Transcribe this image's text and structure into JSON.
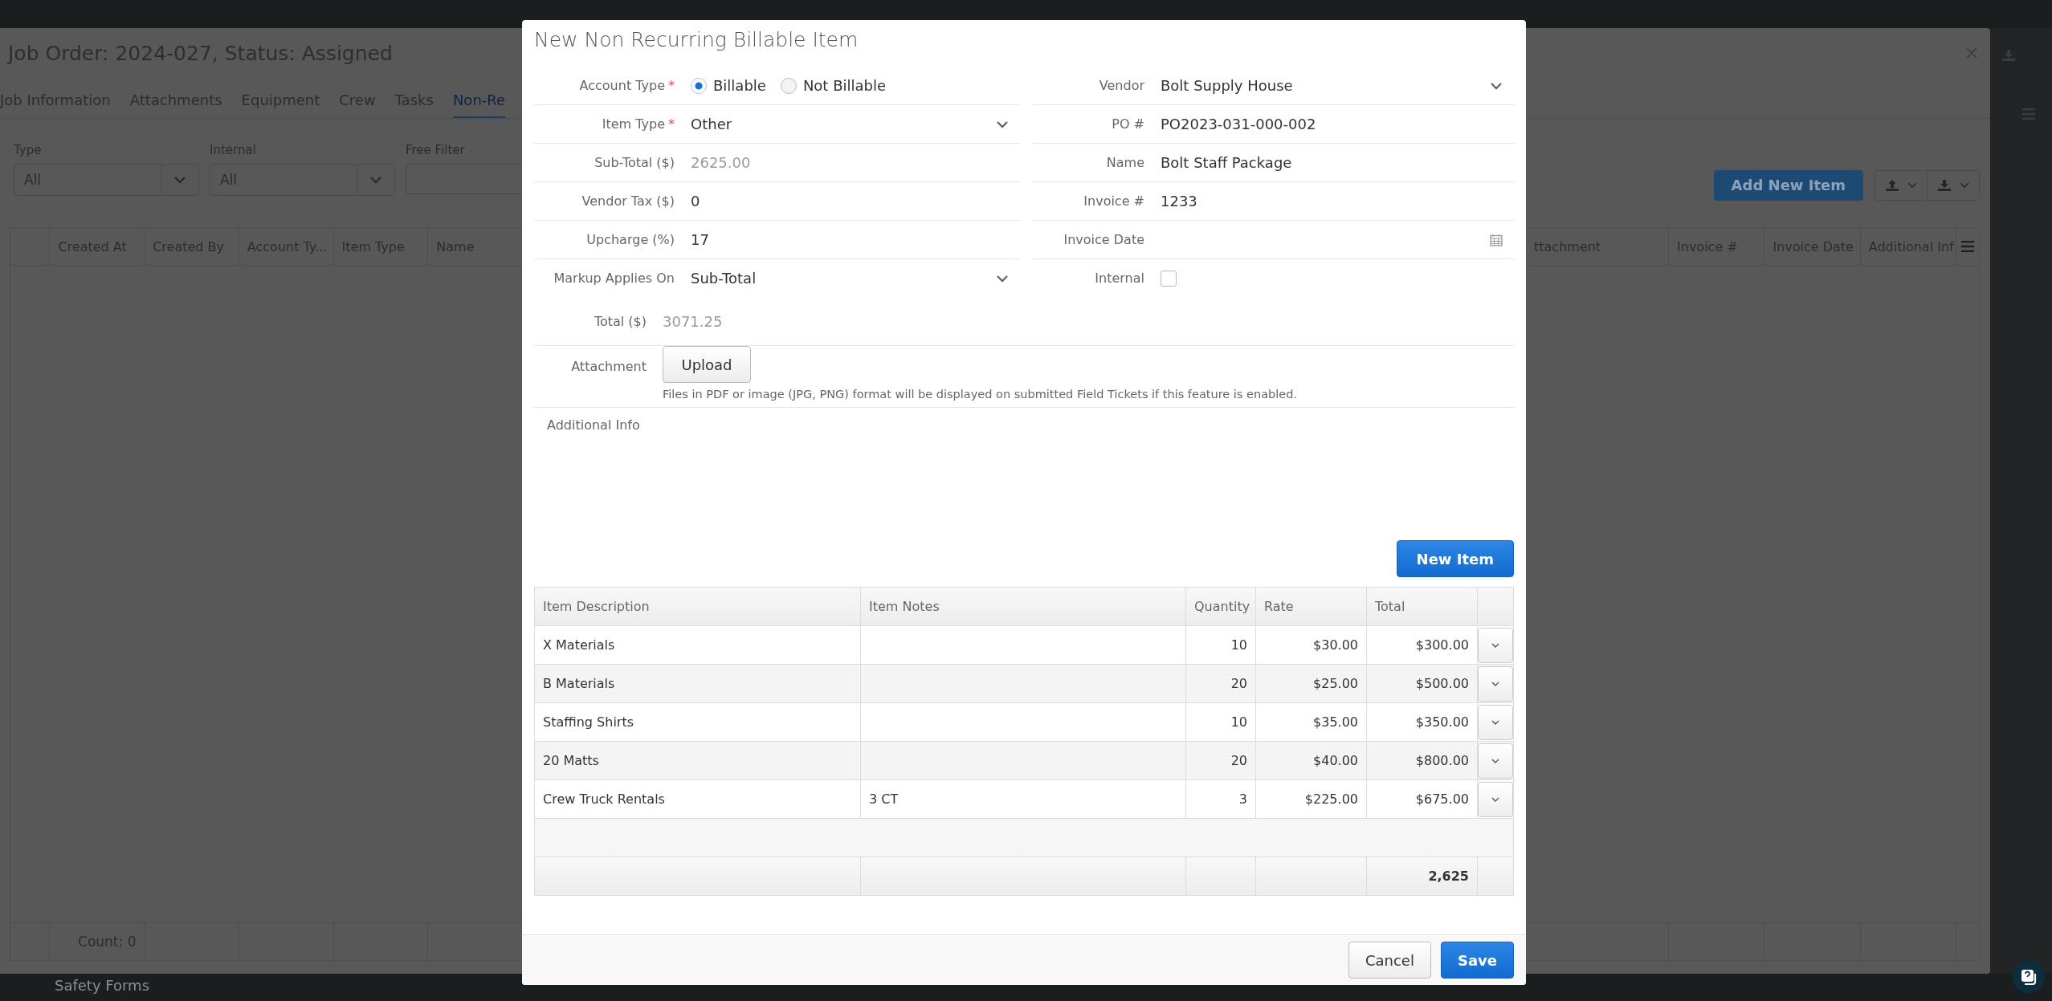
{
  "background": {
    "title": "Job Order: 2024-027, Status: Assigned",
    "tabs": [
      {
        "label": "Job Information",
        "selected": false
      },
      {
        "label": "Attachments",
        "selected": false
      },
      {
        "label": "Equipment",
        "selected": false
      },
      {
        "label": "Crew",
        "selected": false
      },
      {
        "label": "Tasks",
        "selected": false
      },
      {
        "label": "Non-Re",
        "selected": true
      }
    ],
    "filters": [
      {
        "label": "Type",
        "kind": "select",
        "value": "All"
      },
      {
        "label": "Internal",
        "kind": "select",
        "value": "All"
      },
      {
        "label": "Free Filter",
        "kind": "text"
      }
    ],
    "add_button": "Add New Item",
    "table_left_columns": [
      "Created At",
      "Created By",
      "Account Ty...",
      "Item Type",
      "Name"
    ],
    "table_right_columns": [
      "ttachment",
      "Invoice #",
      "Invoice Date",
      "Additional Inf"
    ],
    "count": "Count: 0",
    "sidebar_item": "Safety Forms"
  },
  "dialog": {
    "title": "New Non Recurring Billable Item",
    "left_fields": [
      {
        "label": "Account Type",
        "required_mark": "*",
        "kind": "radio",
        "options": [
          {
            "label": "Billable",
            "selected": true
          },
          {
            "label": "Not Billable",
            "selected": false
          }
        ]
      },
      {
        "label": "Item Type",
        "required_mark": "*",
        "kind": "select",
        "value": "Other"
      },
      {
        "label": "Sub-Total ($)",
        "kind": "readonly",
        "value": "2625.00"
      },
      {
        "label": "Vendor Tax ($)",
        "kind": "text",
        "value": "0"
      },
      {
        "label": "Upcharge (%)",
        "kind": "text",
        "value": "17"
      },
      {
        "label": "Markup Applies On",
        "kind": "select",
        "value": "Sub-Total"
      }
    ],
    "right_fields": [
      {
        "label": "Vendor",
        "kind": "select",
        "value": "Bolt Supply House"
      },
      {
        "label": "PO #",
        "kind": "text",
        "value": "PO2023-031-000-002"
      },
      {
        "label": "Name",
        "kind": "text",
        "value": "Bolt Staff Package"
      },
      {
        "label": "Invoice #",
        "kind": "text",
        "value": "1233"
      },
      {
        "label": "Invoice Date",
        "kind": "date"
      },
      {
        "label": "Internal",
        "kind": "checkbox",
        "checked": false
      }
    ],
    "total": {
      "label": "Total ($)",
      "value": "3071.25"
    },
    "attachment": {
      "label": "Attachment",
      "button": "Upload",
      "hint": "Files in PDF or image (JPG, PNG) format will be displayed on submitted Field Tickets if this feature is enabled."
    },
    "additional_info": {
      "label": "Additional Info"
    },
    "new_item_button": "New Item",
    "table": {
      "columns": [
        {
          "label": "Item Description",
          "kind": "text"
        },
        {
          "label": "Item Notes",
          "kind": "text"
        },
        {
          "label": "Quantity",
          "kind": "number"
        },
        {
          "label": "Rate",
          "kind": "number"
        },
        {
          "label": "Total",
          "kind": "number"
        }
      ],
      "rows": [
        [
          "X Materials",
          "",
          "10",
          "$30.00",
          "$300.00"
        ],
        [
          "B Materials",
          "",
          "20",
          "$25.00",
          "$500.00"
        ],
        [
          "Staffing Shirts",
          "",
          "10",
          "$35.00",
          "$350.00"
        ],
        [
          "20 Matts",
          "",
          "20",
          "$40.00",
          "$800.00"
        ],
        [
          "Crew Truck Rentals",
          "3 CT",
          "3",
          "$225.00",
          "$675.00"
        ]
      ],
      "footer_total": "2,625"
    },
    "buttons": [
      {
        "label": "Cancel",
        "kind": "default"
      },
      {
        "label": "Save",
        "kind": "primary"
      }
    ]
  }
}
